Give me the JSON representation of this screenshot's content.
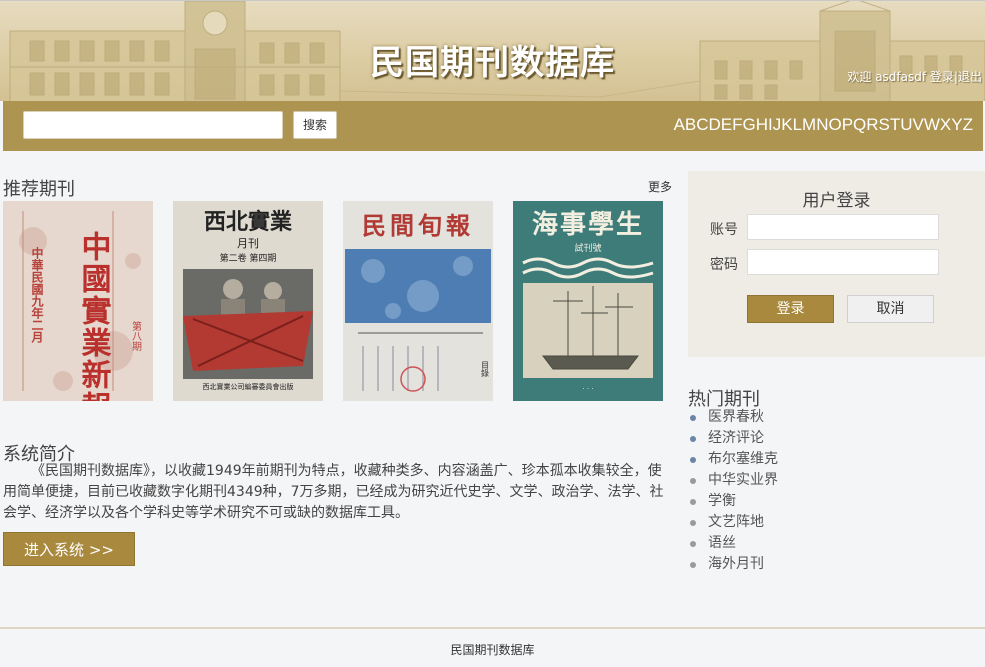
{
  "header": {
    "title": "民国期刊数据库",
    "welcome": "欢迎 asdfasdf ",
    "login_link": "登录",
    "separator": "|",
    "logout_link": "退出"
  },
  "search": {
    "placeholder": "",
    "button_label": "搜索",
    "alphabet": "ABCDEFGHIJKLMNOPQRSTUVWXYZ"
  },
  "recommended": {
    "title": "推荐期刊",
    "more_label": "更多",
    "covers": [
      {
        "title": "中國實業新報",
        "top_text": "中華民國九年二月",
        "side_text": "第八期"
      },
      {
        "title": "西北實業",
        "sub": "月刊",
        "issue": "第二卷 第四期",
        "footer": "西北實業公司編審委員會出版"
      },
      {
        "title": "民間旬報",
        "bottom": "目錄"
      },
      {
        "title": "海事學生",
        "sub": "試刊號"
      }
    ]
  },
  "intro": {
    "title": "系统简介",
    "text": "《民国期刊数据库》，以收藏1949年前期刊为特点，收藏种类多、内容涵盖广、珍本孤本收集较全，使用简单便捷，目前已收藏数字化期刊4349种，7万多期，已经成为研究近代史学、文学、政治学、法学、社会学、经济学以及各个学科史等学术研究不可或缺的数据库工具。",
    "enter_button": "进入系统 >>"
  },
  "login": {
    "title": "用户登录",
    "account_label": "账号",
    "password_label": "密码",
    "login_button": "登录",
    "cancel_button": "取消"
  },
  "hot": {
    "title": "热门期刊",
    "items": [
      {
        "label": "医界春秋",
        "dot_color": "#6b84a8"
      },
      {
        "label": "经济评论",
        "dot_color": "#6b84a8"
      },
      {
        "label": "布尔塞维克",
        "dot_color": "#6b84a8"
      },
      {
        "label": "中华实业界",
        "dot_color": "#9a9a9a"
      },
      {
        "label": "学衡",
        "dot_color": "#9a9a9a"
      },
      {
        "label": "文艺阵地",
        "dot_color": "#9a9a9a"
      },
      {
        "label": "语丝",
        "dot_color": "#9a9a9a"
      },
      {
        "label": "海外月刊",
        "dot_color": "#9a9a9a"
      }
    ]
  },
  "footer": {
    "text": "民国期刊数据库"
  },
  "colors": {
    "accent": "#ad9450",
    "button": "#a8893e"
  }
}
